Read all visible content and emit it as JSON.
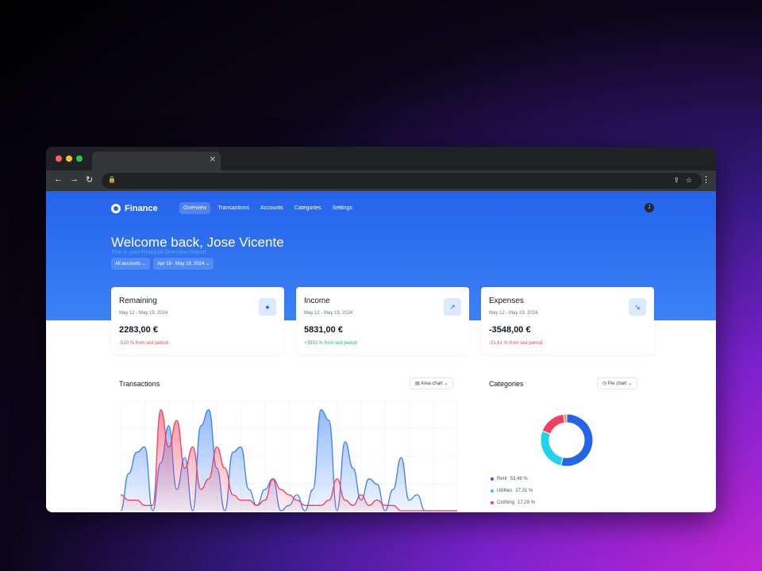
{
  "brand": {
    "name": "Finance"
  },
  "nav": [
    "Overview",
    "Transactions",
    "Accounts",
    "Categories",
    "Settings"
  ],
  "user": {
    "initial": "J"
  },
  "hero": {
    "title": "Welcome back, Jose Vicente",
    "subtitle": "This is your Financial Overview Report",
    "account_filter": "All accounts",
    "date_filter": "Apr 19 - May 19, 2024"
  },
  "cards": [
    {
      "title": "Remaining",
      "date": "May 12 - May 19, 2024",
      "value": "2283,00 €",
      "change": "-510 % from last period",
      "change_color": "#ef4444",
      "icon": "piggy-bank-icon"
    },
    {
      "title": "Income",
      "date": "May 12 - May 19, 2024",
      "value": "5831,00 €",
      "change": "+3533 % from last period",
      "change_color": "#10b981",
      "icon": "trending-up-icon"
    },
    {
      "title": "Expenses",
      "date": "May 12 - May 19, 2024",
      "value": "-3548,00 €",
      "change": "-21,61 % from last period",
      "change_color": "#ef4444",
      "icon": "trending-down-icon"
    }
  ],
  "transactions": {
    "title": "Transactions",
    "chart_type_label": "Area chart"
  },
  "categories": {
    "title": "Categories",
    "chart_type_label": "Pie chart",
    "legend": [
      {
        "name": "Rent",
        "percent": "53,48 %",
        "color": "#2563eb"
      },
      {
        "name": "Utilities",
        "percent": "27,31 %",
        "color": "#22d3ee"
      },
      {
        "name": "Clothing",
        "percent": "17,29 %",
        "color": "#f43f5e"
      }
    ]
  },
  "chart_data": [
    {
      "type": "area",
      "x": [
        0,
        1,
        2,
        3,
        4,
        5,
        6,
        7,
        8,
        9,
        10,
        11,
        12,
        13,
        14,
        15,
        16,
        17,
        18,
        19,
        20,
        21,
        22,
        23,
        24,
        25,
        26,
        27,
        28,
        29,
        30,
        31,
        32,
        33,
        34,
        35,
        36,
        37,
        38,
        39,
        40,
        41,
        42
      ],
      "series": [
        {
          "color": "#3b82f6",
          "values": [
            0,
            35,
            55,
            60,
            0,
            45,
            80,
            20,
            50,
            0,
            80,
            95,
            40,
            0,
            55,
            60,
            20,
            5,
            20,
            30,
            0,
            5,
            15,
            0,
            20,
            95,
            85,
            0,
            65,
            40,
            10,
            30,
            25,
            0,
            20,
            50,
            10,
            15,
            0,
            0,
            0,
            0,
            0
          ]
        },
        {
          "color": "#f43f5e",
          "values": [
            15,
            10,
            10,
            5,
            5,
            95,
            60,
            85,
            40,
            60,
            20,
            30,
            60,
            40,
            15,
            10,
            10,
            5,
            10,
            30,
            20,
            15,
            10,
            5,
            5,
            5,
            10,
            30,
            10,
            5,
            15,
            5,
            10,
            5,
            5,
            0,
            0,
            0,
            0,
            0,
            0,
            0,
            0
          ]
        }
      ]
    },
    {
      "type": "pie",
      "categories": [
        "Rent",
        "Utilities",
        "Clothing"
      ],
      "values": [
        53.48,
        27.31,
        17.29
      ]
    }
  ]
}
